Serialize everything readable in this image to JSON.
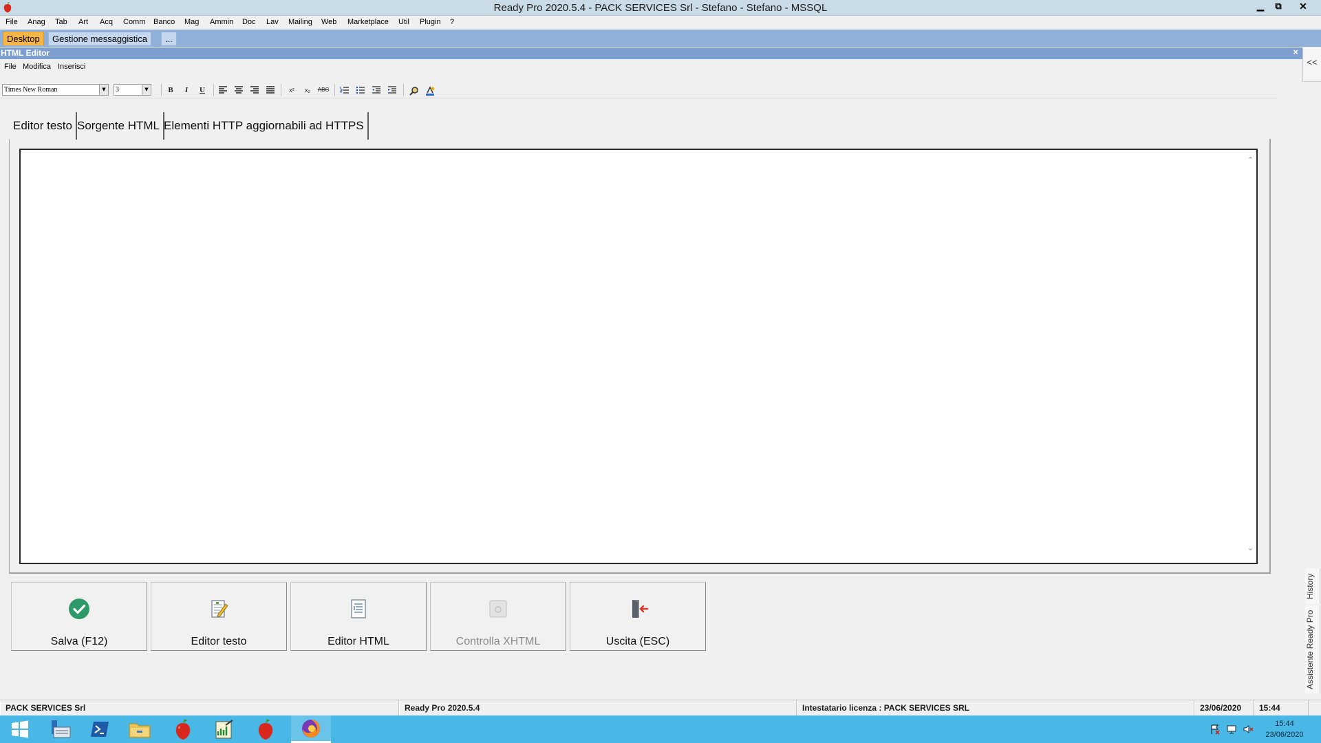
{
  "window": {
    "title": "Ready Pro 2020.5.4 - PACK SERVICES Srl - Stefano - Stefano - MSSQL",
    "controls": [
      "minimize",
      "restore",
      "close"
    ]
  },
  "main_menu": [
    "File",
    "Anag",
    "Tab",
    "Art",
    "Acq",
    "Comm",
    "Banco",
    "Mag",
    "Ammin",
    "Doc",
    "Lav",
    "Mailing",
    "Web",
    "Marketplace",
    "Util",
    "Plugin",
    "?"
  ],
  "desktop_tabs": [
    {
      "label": "Desktop",
      "active": true
    },
    {
      "label": "Gestione messaggistica",
      "active": false
    },
    {
      "label": "...",
      "active": false
    }
  ],
  "editor_window": {
    "caption": "HTML Editor",
    "close_glyph": "×",
    "collapse_glyph": "<<"
  },
  "editor_menu": [
    "File",
    "Modifica",
    "Inserisci"
  ],
  "format_toolbar": {
    "font_name": "Times New Roman",
    "font_size": "3",
    "buttons": [
      "bold-icon",
      "italic-icon",
      "underline-icon",
      "align-left-icon",
      "align-center-icon",
      "align-right-icon",
      "justify-icon",
      "superscript-icon",
      "subscript-icon",
      "strikethrough-icon",
      "numbered-list-icon",
      "bullet-list-icon",
      "outdent-icon",
      "indent-icon",
      "find-icon",
      "text-color-icon"
    ],
    "labels": {
      "bold": "B",
      "italic": "I",
      "underline": "U",
      "superscript": "x²",
      "subscript": "x₂",
      "strike": "ABC"
    }
  },
  "editor_tabs": [
    {
      "label": "Editor testo",
      "active": true
    },
    {
      "label": "Sorgente HTML",
      "active": false
    },
    {
      "label": "Elementi HTTP aggiornabili ad HTTPS",
      "active": false
    }
  ],
  "action_buttons": [
    {
      "label": "Salva (F12)",
      "icon": "check-circle-icon",
      "enabled": true
    },
    {
      "label": "Editor testo",
      "icon": "edit-document-icon",
      "enabled": true
    },
    {
      "label": "Editor HTML",
      "icon": "html-document-icon",
      "enabled": true
    },
    {
      "label": "Controlla XHTML",
      "icon": "xhtml-check-icon",
      "enabled": false
    },
    {
      "label": "Uscita (ESC)",
      "icon": "exit-door-icon",
      "enabled": true
    }
  ],
  "side_panels": [
    "History",
    "Assistente Ready Pro"
  ],
  "status_bar": {
    "company": "PACK SERVICES Srl",
    "version": "Ready Pro 2020.5.4",
    "license": "Intestatario licenza : PACK SERVICES SRL",
    "date": "23/06/2020",
    "time": "15:44"
  },
  "taskbar": {
    "apps": [
      "start-icon",
      "server-manager-icon",
      "powershell-icon",
      "file-explorer-icon",
      "ready-pro-icon",
      "chart-app-icon",
      "ready-pro-running-icon",
      "firefox-icon"
    ],
    "clock_time": "15:44",
    "clock_date": "23/06/2020"
  },
  "colors": {
    "titlebar": "#c8dbe6",
    "tabstrip": "#8fb0d8",
    "active_tab": "#f5b547",
    "taskbar": "#4ab8e6",
    "save_green": "#2e9a6a"
  }
}
